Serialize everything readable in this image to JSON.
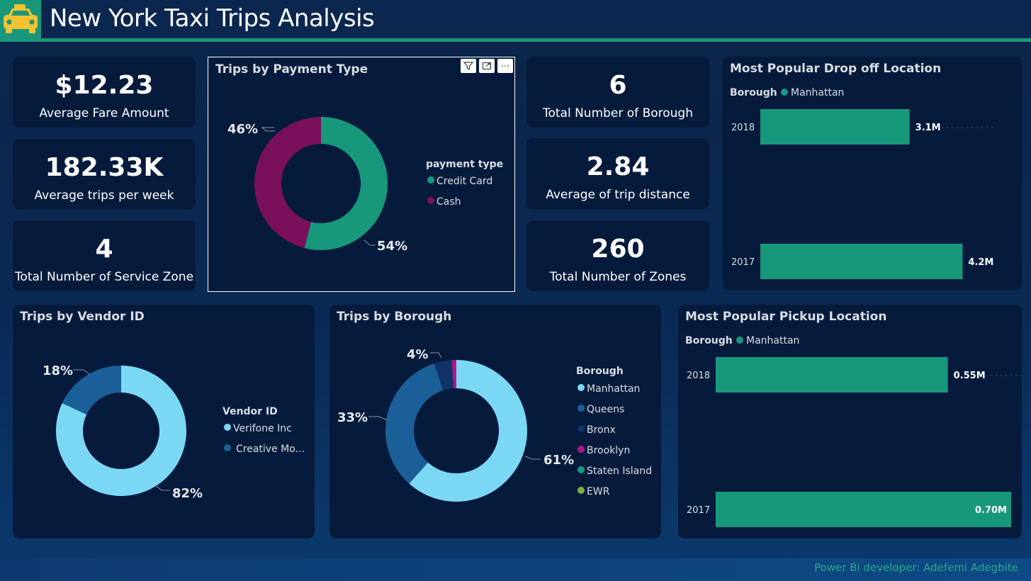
{
  "header": {
    "title": "New York Taxi Trips Analysis",
    "logo_icon": "taxi-icon"
  },
  "kpis": {
    "avg_fare": {
      "value": "$12.23",
      "label": "Average Fare Amount"
    },
    "avg_trips_week": {
      "value": "182.33K",
      "label": "Average trips per week"
    },
    "service_zones": {
      "value": "4",
      "label": "Total Number of Service Zone"
    },
    "boroughs": {
      "value": "6",
      "label": "Total Number of Borough"
    },
    "avg_distance": {
      "value": "2.84",
      "label": "Average of trip distance"
    },
    "zones": {
      "value": "260",
      "label": "Total Number of Zones"
    }
  },
  "payment_panel": {
    "title": "Trips by Payment Type",
    "toolbar": {
      "filter_icon": "filter-icon",
      "focus_icon": "focus-mode-icon",
      "more_label": "⋯"
    }
  },
  "dropoff_panel": {
    "title": "Most Popular Drop off Location"
  },
  "vendor_panel": {
    "title": "Trips by Vendor ID"
  },
  "borough_panel": {
    "title": "Trips by Borough"
  },
  "pickup_panel": {
    "title": "Most Popular Pickup Location"
  },
  "footer": {
    "text": "Power Bi developer: Adefemi Adegbite"
  },
  "colors": {
    "green": "#17987b",
    "purple": "#7a0f5e",
    "light_blue": "#7bd8f5",
    "mid_blue": "#1b5f99",
    "navy": "#12336a",
    "magenta": "#b0188a",
    "lime": "#7cb03a"
  },
  "chart_data": [
    {
      "id": "payment",
      "type": "pie",
      "legend_title": "payment type",
      "legend_position": "right",
      "slices": [
        {
          "name": "Credit Card",
          "value": 54,
          "label": "54%",
          "color": "#17987b"
        },
        {
          "name": "Cash",
          "value": 46,
          "label": "46%",
          "color": "#7a0f5e"
        }
      ]
    },
    {
      "id": "dropoff",
      "type": "bar",
      "orientation": "horizontal",
      "legend_title": "Borough",
      "legend_position": "top-left",
      "series": [
        {
          "name": "Manhattan",
          "color": "#17987b"
        }
      ],
      "categories": [
        "2018",
        "2017"
      ],
      "values": [
        3.1,
        4.2
      ],
      "value_labels": [
        "3.1M",
        "4.2M"
      ],
      "xlim": [
        0,
        4.4
      ]
    },
    {
      "id": "vendor",
      "type": "pie",
      "legend_title": "Vendor ID",
      "legend_position": "right",
      "slices": [
        {
          "name": "Verifone Inc",
          "value": 82,
          "label": "82%",
          "color": "#7bd8f5"
        },
        {
          "name": "Creative Mo...",
          "value": 18,
          "label": "18%",
          "color": "#1b5f99"
        }
      ]
    },
    {
      "id": "borough",
      "type": "pie",
      "legend_title": "Borough",
      "legend_position": "right",
      "slices": [
        {
          "name": "Manhattan",
          "value": 61,
          "label": "61%",
          "color": "#7bd8f5"
        },
        {
          "name": "Queens",
          "value": 33,
          "label": "33%",
          "color": "#1b5f99"
        },
        {
          "name": "Bronx",
          "value": 4,
          "label": "4%",
          "color": "#12336a"
        },
        {
          "name": "Brooklyn",
          "value": 1,
          "label": "",
          "color": "#b0188a"
        },
        {
          "name": "Staten Island",
          "value": 0,
          "label": "",
          "color": "#17987b"
        },
        {
          "name": "EWR",
          "value": 0,
          "label": "",
          "color": "#7cb03a"
        }
      ]
    },
    {
      "id": "pickup",
      "type": "bar",
      "orientation": "horizontal",
      "legend_title": "Borough",
      "legend_position": "top-left",
      "series": [
        {
          "name": "Manhattan",
          "color": "#17987b"
        }
      ],
      "categories": [
        "2018",
        "2017"
      ],
      "values": [
        0.55,
        0.7
      ],
      "value_labels": [
        "0.55M",
        "0.70M"
      ],
      "xlim": [
        0,
        0.7
      ]
    }
  ]
}
